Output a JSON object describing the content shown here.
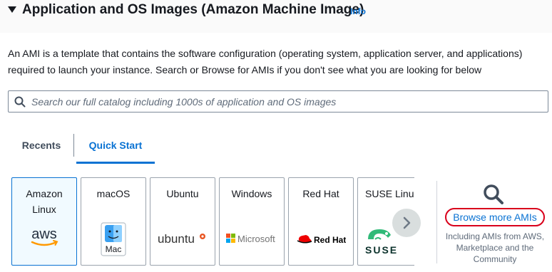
{
  "section": {
    "title": "Application and OS Images (Amazon Machine Image)",
    "info_link": "Info"
  },
  "description": "An AMI is a template that contains the software configuration (operating system, application server, and applications) required to launch your instance. Search or Browse for AMIs if you don't see what you are looking for below",
  "search": {
    "placeholder": "Search our full catalog including 1000s of application and OS images",
    "value": ""
  },
  "tabs": [
    {
      "label": "Recents",
      "active": false
    },
    {
      "label": "Quick Start",
      "active": true
    }
  ],
  "os_tiles": [
    {
      "name": "Amazon Linux",
      "logo_text": "aws",
      "icon": "aws-logo-icon",
      "selected": true
    },
    {
      "name": "macOS",
      "logo_text": "Mac",
      "icon": "mac-finder-icon",
      "selected": false
    },
    {
      "name": "Ubuntu",
      "logo_text": "ubuntu",
      "icon": "ubuntu-logo-icon",
      "selected": false
    },
    {
      "name": "Windows",
      "logo_text": "Microsoft",
      "icon": "microsoft-logo-icon",
      "selected": false
    },
    {
      "name": "Red Hat",
      "logo_text": "Red Hat",
      "icon": "redhat-logo-icon",
      "selected": false
    },
    {
      "name": "SUSE Linux",
      "logo_text": "SUSE",
      "icon": "suse-logo-icon",
      "selected": false
    }
  ],
  "browse": {
    "link": "Browse more AMIs",
    "subtext": "Including AMIs from AWS, Marketplace and the Community"
  },
  "colors": {
    "link_blue": "#0972d3",
    "highlight_red": "#d9001b",
    "aws_orange": "#ff9900",
    "ubuntu_orange": "#e95420",
    "redhat_red": "#ee0000",
    "suse_green": "#30ba78"
  }
}
